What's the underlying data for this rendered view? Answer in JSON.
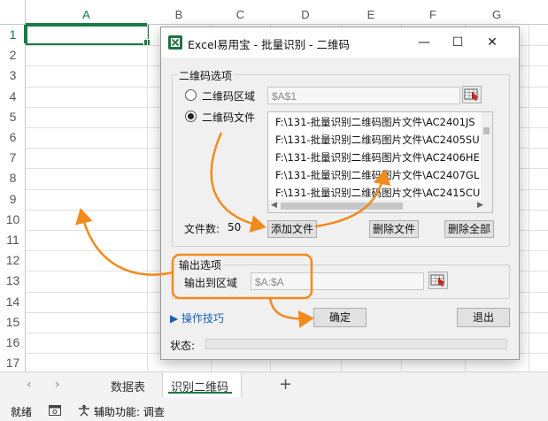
{
  "sheet": {
    "columns": [
      "A",
      "B",
      "C",
      "D",
      "E",
      "F",
      "G"
    ],
    "rows": [
      "1",
      "2",
      "3",
      "4",
      "5",
      "6",
      "7",
      "8",
      "9",
      "10",
      "11",
      "12",
      "13",
      "14",
      "15",
      "16",
      "17"
    ],
    "selected_column": "A",
    "selected_row": "1",
    "tabs": [
      {
        "label": "数据表",
        "active": false
      },
      {
        "label": "识别二维码",
        "active": true
      }
    ],
    "add_tab": "+",
    "nav_prev": "‹",
    "nav_next": "›"
  },
  "statusbar": {
    "ready": "就绪",
    "accessibility": "辅助功能: 调查"
  },
  "dialog": {
    "title": "Excel易用宝 - 批量识别 - 二维码",
    "minimize": "—",
    "maximize": "☐",
    "close": "✕",
    "qr_options": {
      "legend": "二维码选项",
      "radio_range": {
        "label": "二维码区域",
        "selected": false,
        "value": "$A$1"
      },
      "radio_file": {
        "label": "二维码文件",
        "selected": true
      },
      "files": [
        "F:\\131-批量识别二维码图片文件\\AC2401JS",
        "F:\\131-批量识别二维码图片文件\\AC2405SU",
        "F:\\131-批量识别二维码图片文件\\AC2406HE",
        "F:\\131-批量识别二维码图片文件\\AC2407GL",
        "F:\\131-批量识别二维码图片文件\\AC2415CU"
      ],
      "file_count_label": "文件数:",
      "file_count": "50",
      "add_file": "添加文件",
      "delete_file": "删除文件",
      "delete_all": "删除全部"
    },
    "output_options": {
      "legend": "输出选项",
      "output_label": "输出到区域",
      "output_value": "$A:$A"
    },
    "tips": "▶ 操作技巧",
    "ok": "确定",
    "exit": "退出",
    "status_label": "状态:"
  },
  "colors": {
    "accent_green": "#1a7a43",
    "annotation_orange": "#f28a1c"
  }
}
